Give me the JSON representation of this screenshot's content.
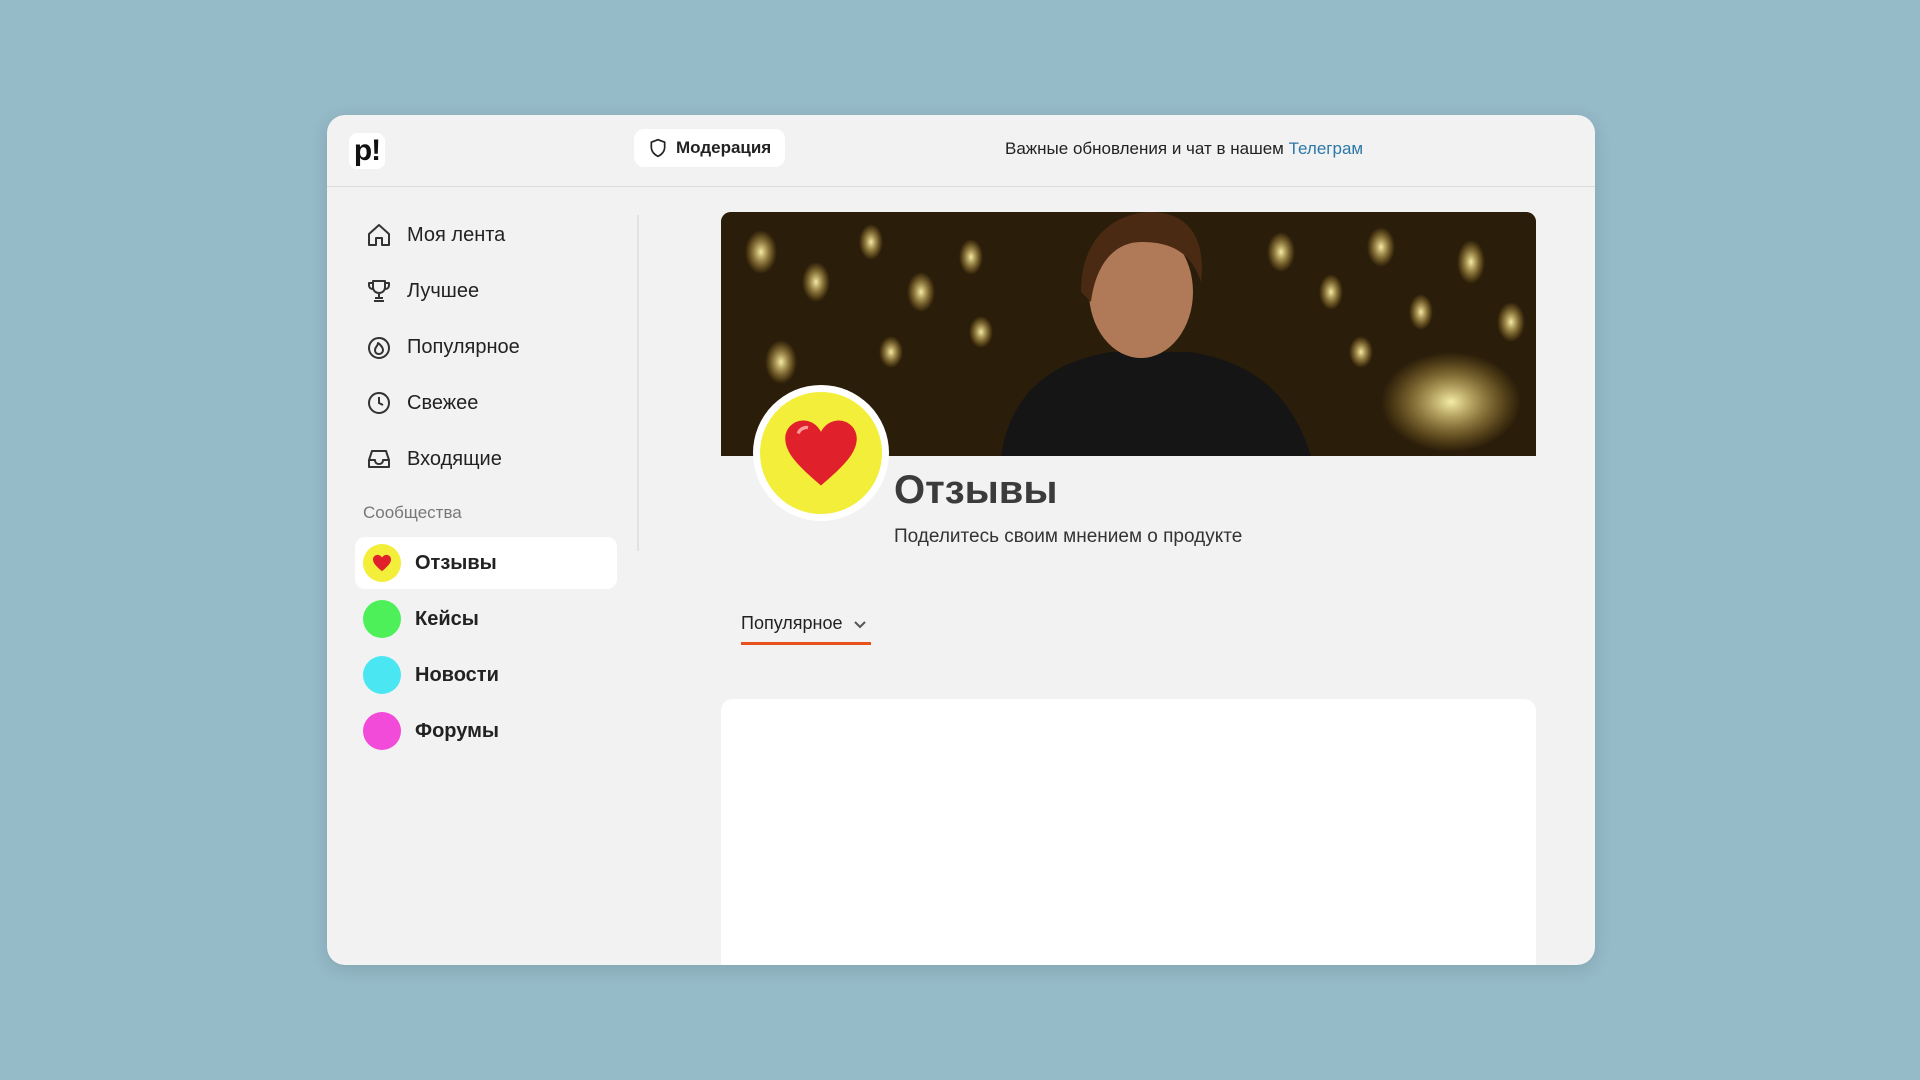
{
  "header": {
    "logo_text": "p!",
    "moderation_label": "Модерация",
    "announcement_text": "Важные обновления и чат в нашем ",
    "announcement_link": "Телеграм"
  },
  "sidebar": {
    "nav": [
      {
        "label": "Моя лента",
        "icon": "home-icon"
      },
      {
        "label": "Лучшее",
        "icon": "trophy-icon"
      },
      {
        "label": "Популярное",
        "icon": "fire-icon"
      },
      {
        "label": "Свежее",
        "icon": "clock-icon"
      },
      {
        "label": "Входящие",
        "icon": "inbox-icon"
      }
    ],
    "section_label": "Сообщества",
    "communities": [
      {
        "label": "Отзывы",
        "color": "#f2ee3a",
        "active": true
      },
      {
        "label": "Кейсы",
        "color": "#4ef05a"
      },
      {
        "label": "Новости",
        "color": "#4ae6f2"
      },
      {
        "label": "Форумы",
        "color": "#f24ad9"
      }
    ]
  },
  "community": {
    "title": "Отзывы",
    "description": "Поделитесь своим мнением о продукте",
    "avatar_color": "#f2ee3a",
    "avatar_icon": "heart-icon"
  },
  "feed": {
    "sort_label": "Популярное"
  },
  "colors": {
    "accent": "#e8511c",
    "link": "#2d78a8",
    "background": "#95bac8"
  }
}
